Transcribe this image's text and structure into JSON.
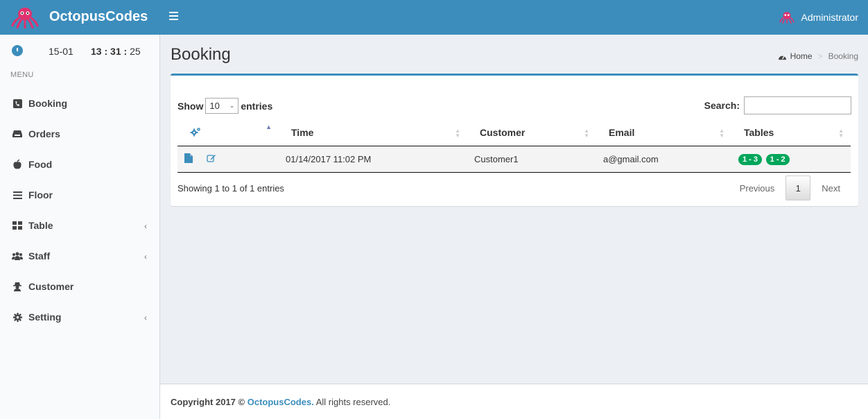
{
  "header": {
    "brand": "OctopusCodes",
    "user_name": "Administrator"
  },
  "sidebar": {
    "clock": {
      "date": "15-01",
      "hours": "13",
      "minutes": "31",
      "seconds": "25"
    },
    "menu_header": "MENU",
    "items": [
      {
        "label": "Booking",
        "icon": "phone-icon",
        "has_submenu": false
      },
      {
        "label": "Orders",
        "icon": "inbox-icon",
        "has_submenu": false
      },
      {
        "label": "Food",
        "icon": "apple-icon",
        "has_submenu": false
      },
      {
        "label": "Floor",
        "icon": "list-icon",
        "has_submenu": false
      },
      {
        "label": "Table",
        "icon": "grid-icon",
        "has_submenu": true
      },
      {
        "label": "Staff",
        "icon": "users-icon",
        "has_submenu": true
      },
      {
        "label": "Customer",
        "icon": "user-secret-icon",
        "has_submenu": false
      },
      {
        "label": "Setting",
        "icon": "gear-icon",
        "has_submenu": true
      }
    ]
  },
  "content": {
    "title": "Booking",
    "breadcrumb": {
      "home": "Home",
      "current": "Booking"
    },
    "table": {
      "show_label": "Show",
      "entries_value": "10",
      "entries_label": "entries",
      "search_label": "Search:",
      "search_value": "",
      "columns": [
        "",
        "Time",
        "Customer",
        "Email",
        "Tables"
      ],
      "rows": [
        {
          "time": "01/14/2017 11:02 PM",
          "customer": "Customer1",
          "email": "a@gmail.com",
          "tables": [
            "1 - 3",
            "1 - 2"
          ]
        }
      ],
      "info": "Showing 1 to 1 of 1 entries",
      "pagination": {
        "previous": "Previous",
        "page": "1",
        "next": "Next"
      }
    }
  },
  "footer": {
    "prefix": "Copyright 2017 ©",
    "brand": "OctopusCodes.",
    "suffix": "All rights reserved."
  },
  "colors": {
    "primary": "#3c8dbc",
    "success_badge": "#00a65a",
    "sidebar_bg": "#f9fafc",
    "content_bg": "#ecf0f5"
  }
}
